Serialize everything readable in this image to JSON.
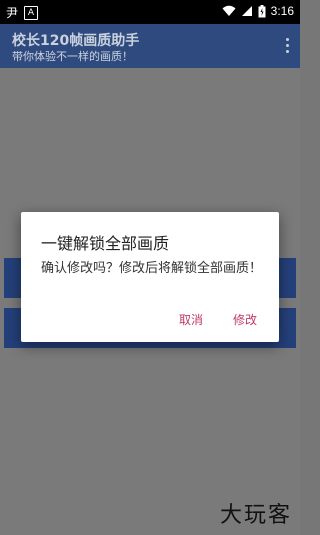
{
  "status_bar": {
    "left_icons": [
      "carrier-icon",
      "a-notification-icon"
    ],
    "left_icon_chars": [
      "尹",
      "A"
    ],
    "time": "3:16"
  },
  "app_bar": {
    "title": "校长120帧画质助手",
    "subtitle": "带你体验不一样的画质！",
    "background": "#2e4a7e"
  },
  "dialog": {
    "title": "一键解锁全部画质",
    "message": "确认修改吗？修改后将解锁全部画质！",
    "cancel_label": "取消",
    "confirm_label": "修改",
    "accent_color": "#c0386a"
  },
  "watermark": {
    "text": "大玩客"
  }
}
